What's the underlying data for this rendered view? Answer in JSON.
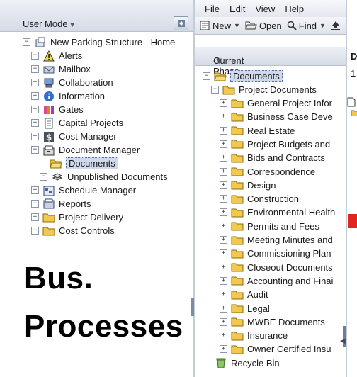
{
  "left_panel": {
    "user_mode": "User Mode",
    "tree": [
      {
        "label": "New Parking Structure - Home",
        "icon": "project-icon",
        "expander": "−"
      },
      {
        "label": "Alerts",
        "icon": "alert-icon",
        "expander": "−"
      },
      {
        "label": "Mailbox",
        "icon": "mailbox-icon",
        "expander": "−"
      },
      {
        "label": "Collaboration",
        "icon": "collaboration-icon",
        "expander": "+"
      },
      {
        "label": "Information",
        "icon": "information-icon",
        "expander": "+"
      },
      {
        "label": "Gates",
        "icon": "gates-icon",
        "expander": "−"
      },
      {
        "label": "Capital Projects",
        "icon": "capital-projects-icon",
        "expander": "+"
      },
      {
        "label": "Cost Manager",
        "icon": "cost-manager-icon",
        "expander": "+"
      },
      {
        "label": "Document Manager",
        "icon": "document-manager-icon",
        "expander": "−"
      },
      {
        "label": "Documents",
        "icon": "folder-open-icon",
        "expander": ""
      },
      {
        "label": "Unpublished Documents",
        "icon": "stack-icon",
        "expander": "−"
      },
      {
        "label": "Schedule Manager",
        "icon": "schedule-icon",
        "expander": "+"
      },
      {
        "label": "Reports",
        "icon": "reports-icon",
        "expander": "+"
      },
      {
        "label": "Project Delivery",
        "icon": "folder-icon",
        "expander": "+"
      },
      {
        "label": "Cost Controls",
        "icon": "folder-icon",
        "expander": "+"
      }
    ]
  },
  "overlay": {
    "line1": "Bus.",
    "line2": "Processes"
  },
  "menubar": {
    "file": "File",
    "edit": "Edit",
    "view": "View",
    "help": "Help"
  },
  "toolbar": {
    "new": "New",
    "open": "Open",
    "find": "Find"
  },
  "phase": {
    "label": "Current Phase"
  },
  "middle_tree": {
    "root": "Documents",
    "project_documents": "Project Documents",
    "folders": [
      "General Project Infor",
      "Business Case Deve",
      "Real Estate",
      "Project Budgets and",
      "Bids and Contracts",
      "Correspondence",
      "Design",
      "Construction",
      "Environmental Health",
      "Permits and Fees",
      "Meeting Minutes and",
      "Commissioning Plan",
      "Closeout Documents",
      "Accounting and Finai",
      "Audit",
      "Legal",
      "MWBE Documents",
      "Insurance",
      "Owner Certified Insu"
    ],
    "recycle_bin": "Recycle Bin"
  },
  "right_panel": {
    "header_letter": "D",
    "number": "1"
  },
  "colors": {
    "accent_red": "#e0261e",
    "folder": "#f2c94c",
    "selection": "#cfd9ea"
  }
}
